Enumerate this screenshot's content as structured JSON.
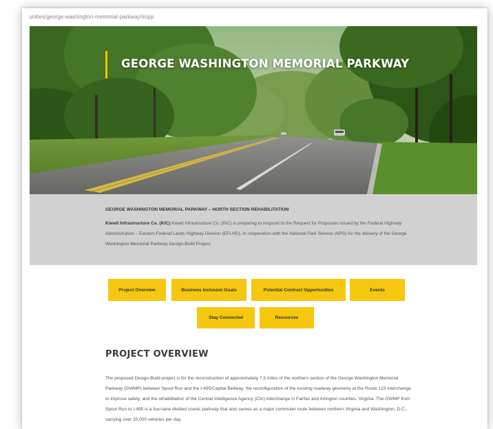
{
  "browser": {
    "url": "unities/george-washington-memorial-parkway/#opp"
  },
  "hero": {
    "title": "GEORGE WASHINGTON MEMORIAL PARKWAY",
    "accent_color": "#f2c500"
  },
  "intro": {
    "heading": "GEORGE WASHINGTON MEMORIAL PARKWAY – NORTH SECTION REHABILITATION",
    "company": "Kiewit Infrastructure Co. (KIC)",
    "text": " Kiewit Infrastructure Co. (KIC) is preparing to respond to the Request for Proposals issued by the Federal Highway Administration – Eastern Federal Lands Highway Division (EFLHD), in cooperation with the National Park Service (NPS) for the delivery of the George Washington Memorial Parkway Design-Build Project."
  },
  "nav": {
    "button_color": "#f5c70f",
    "project_overview": "Project Overview",
    "business_inclusion": "Business Inclusion Goals",
    "contract_opportunities": "Potential Contract Opportunities",
    "events": "Events",
    "stay_connected": "Stay Connected",
    "resources": "Resources"
  },
  "overview": {
    "title": "PROJECT OVERVIEW",
    "text": "The proposed Design-Build project is for the reconstruction of approximately 7.5 miles of the northern section of the George Washington Memorial Parkway (GWMP) between Spout Run and the I-495/Capital Beltway, the reconfiguration of the existing roadway geometry at the Route 123 interchange to improve safety, and the rehabilitation of the Central Intelligence Agency (CIA) interchange in Fairfax and Arlington counties, Virginia.  The GWMP from Spout Run to I-495 is a four-lane divided scenic parkway that also serves as a major commuter route between northern Virginia and Washington, D.C., carrying over 20,000 vehicles per day."
  }
}
